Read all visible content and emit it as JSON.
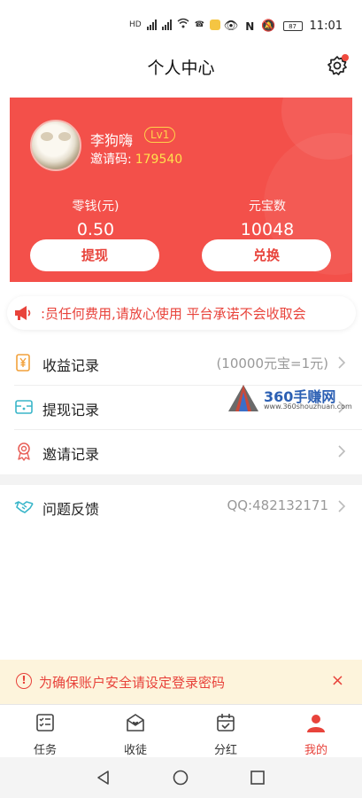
{
  "status_bar": {
    "left_icons": [
      "hd-icon",
      "signal-icon",
      "signal-icon",
      "wifi-icon",
      "call-icon",
      "notification-icon"
    ],
    "right_icons": [
      "eye-icon",
      "nfc-icon",
      "mute-icon",
      "battery-icon"
    ],
    "battery": "87",
    "time": "11:01"
  },
  "header": {
    "title": "个人中心",
    "settings_icon": "gear-icon"
  },
  "profile": {
    "name": "李狗嗨",
    "level": "Lv1",
    "invite_label": "邀请码:",
    "invite_code": "179540",
    "balance_label": "零钱(元)",
    "balance_value": "0.50",
    "coins_label": "元宝数",
    "coins_value": "10048",
    "withdraw_button": "提现",
    "exchange_button": "兑换"
  },
  "notice": {
    "icon": "megaphone-icon",
    "text": ":员任何费用,请放心使用   平台承诺不会收取会"
  },
  "menu": [
    {
      "label": "收益记录",
      "hint": "(10000元宝=1元)",
      "icon": "yuan-note-icon"
    },
    {
      "label": "提现记录",
      "hint": "",
      "icon": "wallet-icon"
    },
    {
      "label": "邀请记录",
      "hint": "",
      "icon": "badge-icon"
    },
    {
      "label": "问题反馈",
      "hint": "QQ:482132171",
      "icon": "handshake-icon"
    }
  ],
  "watermark": {
    "title": "360手赚网",
    "url": "www.360shouzhuan.com"
  },
  "security_tip": {
    "text": "为确保账户安全请设定登录密码",
    "close": "×"
  },
  "tabs": [
    {
      "label": "任务",
      "icon": "task-list-icon",
      "active": false
    },
    {
      "label": "收徒",
      "icon": "envelope-heart-icon",
      "active": false
    },
    {
      "label": "分红",
      "icon": "calendar-check-icon",
      "active": false
    },
    {
      "label": "我的",
      "icon": "user-icon",
      "active": true
    }
  ],
  "colors": {
    "primary": "#f3504a",
    "accent_red": "#e8433b",
    "gold": "#ffd24a",
    "tip_bg": "#fdf4dc"
  }
}
